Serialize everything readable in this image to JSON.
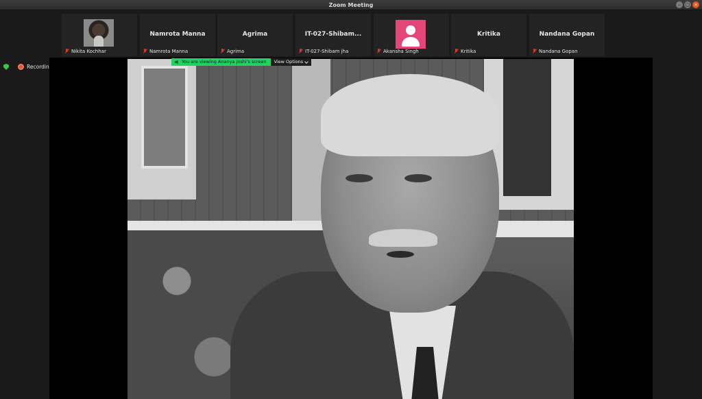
{
  "window": {
    "title": "Zoom Meeting"
  },
  "participants": [
    {
      "tile_name": "",
      "display_name": "Nikita Kochhar",
      "video": "photo"
    },
    {
      "tile_name": "Namrota Manna",
      "display_name": "Namrota Manna",
      "video": "off"
    },
    {
      "tile_name": "Agrima",
      "display_name": "Agrima",
      "video": "off"
    },
    {
      "tile_name": "IT-027-Shibam...",
      "display_name": "IT-027-Shibam jha",
      "video": "off"
    },
    {
      "tile_name": "",
      "display_name": "Akansha Singh",
      "video": "avatar"
    },
    {
      "tile_name": "Kritika",
      "display_name": "Kritika",
      "video": "off"
    },
    {
      "tile_name": "Nandana Gopan",
      "display_name": "Nandana Gopan",
      "video": "off"
    }
  ],
  "status": {
    "recording_label": "Recording"
  },
  "share": {
    "viewing_message": "You are viewing Ananya Joshi's screen",
    "view_options_label": "View Options"
  },
  "colors": {
    "banner": "#23d160",
    "avatar": "#e4467a",
    "mute": "#e0372b",
    "shield": "#3cc24a"
  },
  "icons": [
    "close-icon",
    "maximize-icon",
    "minimize-icon",
    "mic-muted-icon",
    "shield-icon",
    "record-icon",
    "speaker-icon",
    "chevron-down-icon"
  ]
}
